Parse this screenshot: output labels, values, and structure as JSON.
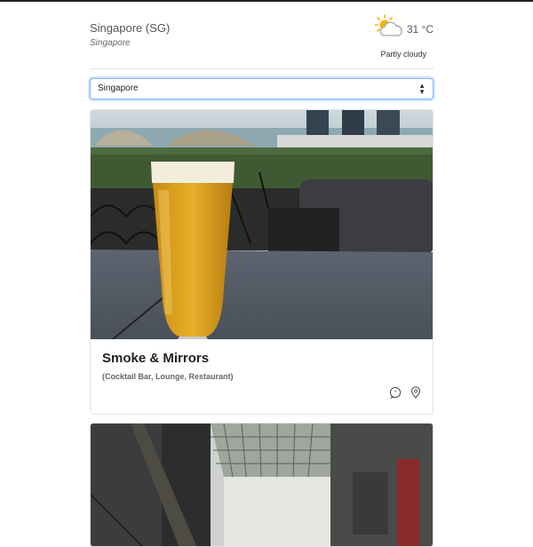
{
  "header": {
    "city_name": "Singapore (SG)",
    "city_sub": "Singapore",
    "temperature": "31 °C",
    "condition": "Partly cloudy",
    "weather_icon": "partly-cloudy-icon"
  },
  "city_select": {
    "value": "Singapore",
    "arrows": "▲▼"
  },
  "venues": [
    {
      "name": "Smoke & Mirrors",
      "categories": "(Cocktail Bar, Lounge, Restaurant)",
      "icons": [
        "quote-icon",
        "map-pin-icon"
      ]
    }
  ],
  "colors": {
    "focus_border": "#86b7fe",
    "sun": "#f6b500",
    "beer": "#e0a21c"
  }
}
